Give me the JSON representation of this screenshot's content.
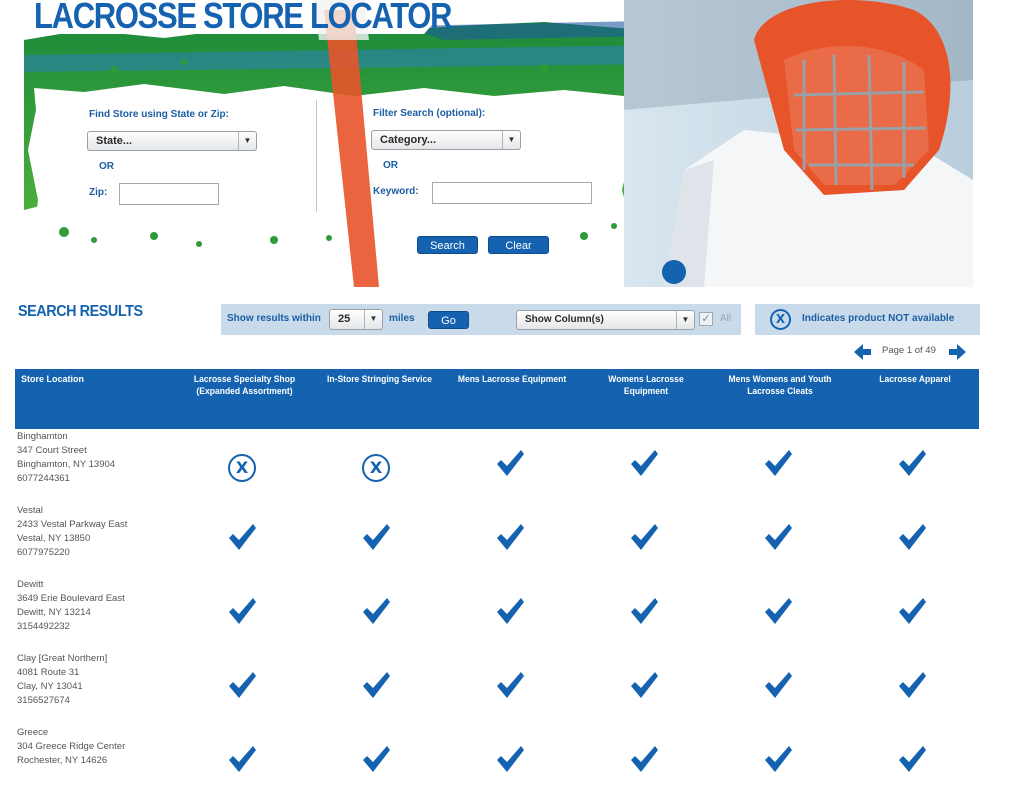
{
  "header": {
    "title": "LACROSSE STORE LOCATOR"
  },
  "search_form": {
    "find_label": "Find Store using State or Zip:",
    "state_select": "State...",
    "or_1": "OR",
    "zip_label": "Zip:",
    "zip_value": "",
    "filter_label": "Filter Search (optional):",
    "category_select": "Category...",
    "or_2": "OR",
    "keyword_label": "Keyword:",
    "keyword_value": "",
    "search_button": "Search",
    "clear_button": "Clear"
  },
  "results_bar": {
    "title": "SEARCH RESULTS",
    "show_within_label": "Show results within",
    "miles_value": "25",
    "miles_label": "miles",
    "go_button": "Go",
    "show_columns_select": "Show Column(s)",
    "all_label": "All",
    "all_checked": true,
    "legend_text": "Indicates product NOT available"
  },
  "pagination": {
    "text": "Page 1 of 49"
  },
  "table": {
    "columns": [
      "Store Location",
      "Lacrosse Specialty Shop (Expanded Assortment)",
      "In-Store Stringing Service",
      "Mens Lacrosse Equipment",
      "Womens Lacrosse Equipment",
      "Mens Womens and Youth Lacrosse Cleats",
      "Lacrosse Apparel"
    ],
    "rows": [
      {
        "name": "Binghamton",
        "address": "347 Court Street",
        "city": "Binghamton, NY 13904",
        "phone": "6077244361",
        "availability": [
          false,
          false,
          true,
          true,
          true,
          true
        ]
      },
      {
        "name": "Vestal",
        "address": "2433 Vestal Parkway East",
        "city": "Vestal, NY 13850",
        "phone": "6077975220",
        "availability": [
          true,
          true,
          true,
          true,
          true,
          true
        ]
      },
      {
        "name": "Dewitt",
        "address": "3649 Erie Boulevard East",
        "city": "Dewitt, NY 13214",
        "phone": "3154492232",
        "availability": [
          true,
          true,
          true,
          true,
          true,
          true
        ]
      },
      {
        "name": "Clay  [Great Northern]",
        "address": "4081 Route 31",
        "city": "Clay, NY 13041",
        "phone": "3156527674",
        "availability": [
          true,
          true,
          true,
          true,
          true,
          true
        ]
      },
      {
        "name": "Greece",
        "address": "304 Greece Ridge Center",
        "city": "Rochester, NY 14626",
        "phone": "",
        "availability": [
          true,
          true,
          true,
          true,
          true,
          true
        ]
      }
    ]
  },
  "colors": {
    "brand_blue": "#1462b0",
    "light_blue_bar": "#c9dbeb",
    "hero_green": "#2f9a3a",
    "helmet_orange": "#e8542a"
  },
  "icons": {
    "available": "check-icon",
    "not_available": "x-circle-icon",
    "prev": "prev-arrow-icon",
    "next": "next-arrow-icon"
  }
}
